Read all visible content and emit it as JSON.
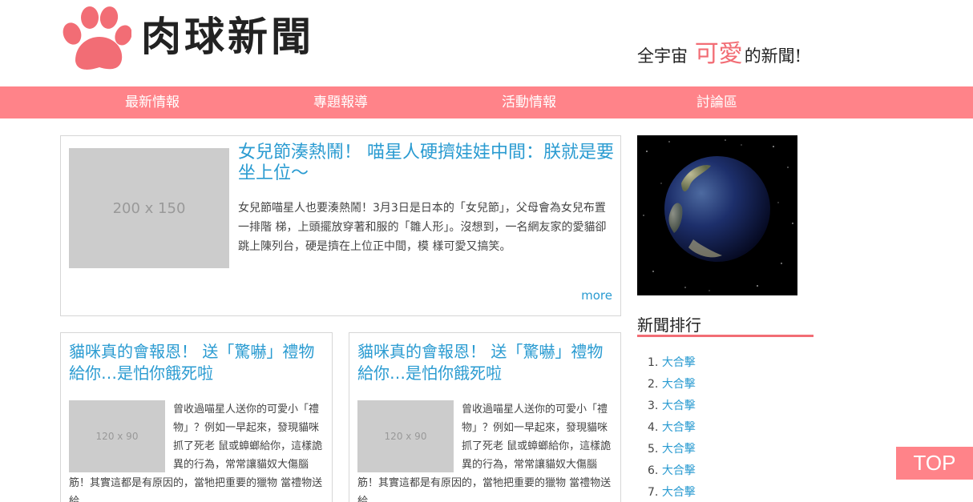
{
  "header": {
    "site_title": "肉球新聞",
    "tagline_prefix": "全宇宙",
    "tagline_accent": "可愛",
    "tagline_suffix": "的新聞!"
  },
  "nav": {
    "items": [
      "最新情報",
      "專題報導",
      "活動情報",
      "討論區"
    ]
  },
  "featured": {
    "image_placeholder": "200 x 150",
    "title": "女兒節湊熱鬧！ 喵星人硬擠娃娃中間：朕就是要坐上位～",
    "text": "女兒節喵星人也要湊熱鬧！3月3日是日本的「女兒節」，父母會為女兒布置一排階 梯，上頭擺放穿著和服的「雛人形」。沒想到，一名網友家的愛貓卻跳上陳列台，硬是擠在上位正中間，模 樣可愛又搞笑。",
    "more_label": "more"
  },
  "cards": [
    {
      "title": "貓咪真的會報恩！ 送「驚嚇」禮物給你…是怕你餓死啦",
      "image_placeholder": "120 x 90",
      "text": "曾收過喵星人送你的可愛小「禮物」？例如一早起來，發現貓咪抓了死老 鼠或蟑螂給你，這樣詭異的行為，常常讓貓奴大傷腦筋！其實這都是有原因的，當牠把重要的獵物 當禮物送給"
    },
    {
      "title": "貓咪真的會報恩！ 送「驚嚇」禮物給你…是怕你餓死啦",
      "image_placeholder": "120 x 90",
      "text": "曾收過喵星人送你的可愛小「禮物」？例如一早起來，發現貓咪抓了死老 鼠或蟑螂給你，這樣詭異的行為，常常讓貓奴大傷腦筋！其實這都是有原因的，當牠把重要的獵物 當禮物送給"
    }
  ],
  "sidebar": {
    "ranking_title": "新聞排行",
    "ranking": [
      "大合擊",
      "大合擊",
      "大合擊",
      "大合擊",
      "大合擊",
      "大合擊",
      "大合擊"
    ]
  },
  "top_button": "TOP",
  "colors": {
    "brand_pink": "#ff8389",
    "accent_red": "#f26d75",
    "link_blue": "#2a9bd1"
  }
}
